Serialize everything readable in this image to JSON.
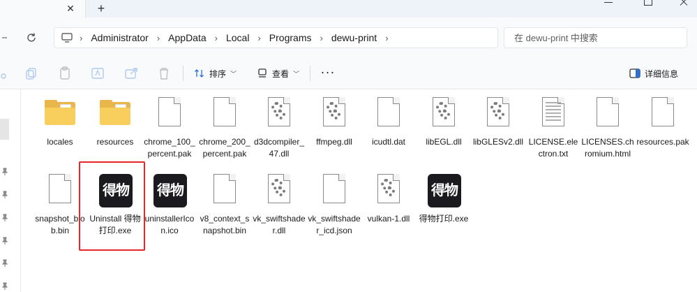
{
  "titlebar": {
    "tab_close_glyph": "✕",
    "new_tab_glyph": "+"
  },
  "address_bar": {
    "breadcrumbs": [
      "Administrator",
      "AppData",
      "Local",
      "Programs",
      "dewu-print"
    ],
    "separator": "›",
    "search_placeholder": "在 dewu-print 中搜索"
  },
  "toolbar": {
    "sort_label": "排序",
    "view_label": "查看",
    "more_glyph": "···",
    "details_label": "详细信息"
  },
  "files": [
    {
      "name": "locales",
      "icon": "folder-icon"
    },
    {
      "name": "resources",
      "icon": "folder-icon"
    },
    {
      "name": "chrome_100_percent.pak",
      "icon": "file-icon"
    },
    {
      "name": "chrome_200_percent.pak",
      "icon": "file-icon"
    },
    {
      "name": "d3dcompiler_47.dll",
      "icon": "dll-icon"
    },
    {
      "name": "ffmpeg.dll",
      "icon": "dll-icon"
    },
    {
      "name": "icudtl.dat",
      "icon": "file-icon"
    },
    {
      "name": "libEGL.dll",
      "icon": "dll-icon"
    },
    {
      "name": "libGLESv2.dll",
      "icon": "dll-icon"
    },
    {
      "name": "LICENSE.electron.txt",
      "icon": "text-file-icon"
    },
    {
      "name": "LICENSES.chromium.html",
      "icon": "file-icon"
    },
    {
      "name": "resources.pak",
      "icon": "file-icon"
    },
    {
      "name": "snapshot_blob.bin",
      "icon": "file-icon"
    },
    {
      "name": "Uninstall 得物打印.exe",
      "icon": "dewu-app-icon",
      "selected_highlight": true
    },
    {
      "name": "uninstallerIcon.ico",
      "icon": "dewu-app-icon"
    },
    {
      "name": "v8_context_snapshot.bin",
      "icon": "file-icon"
    },
    {
      "name": "vk_swiftshader.dll",
      "icon": "dll-icon"
    },
    {
      "name": "vk_swiftshader_icd.json",
      "icon": "file-icon"
    },
    {
      "name": "vulkan-1.dll",
      "icon": "dll-icon"
    },
    {
      "name": "得物打印.exe",
      "icon": "dewu-app-icon"
    }
  ],
  "app_icon_text": "得物",
  "colors": {
    "highlight": "#e8262a",
    "folder": "#f8cf5c",
    "app_icon_bg": "#1b1b1f"
  }
}
